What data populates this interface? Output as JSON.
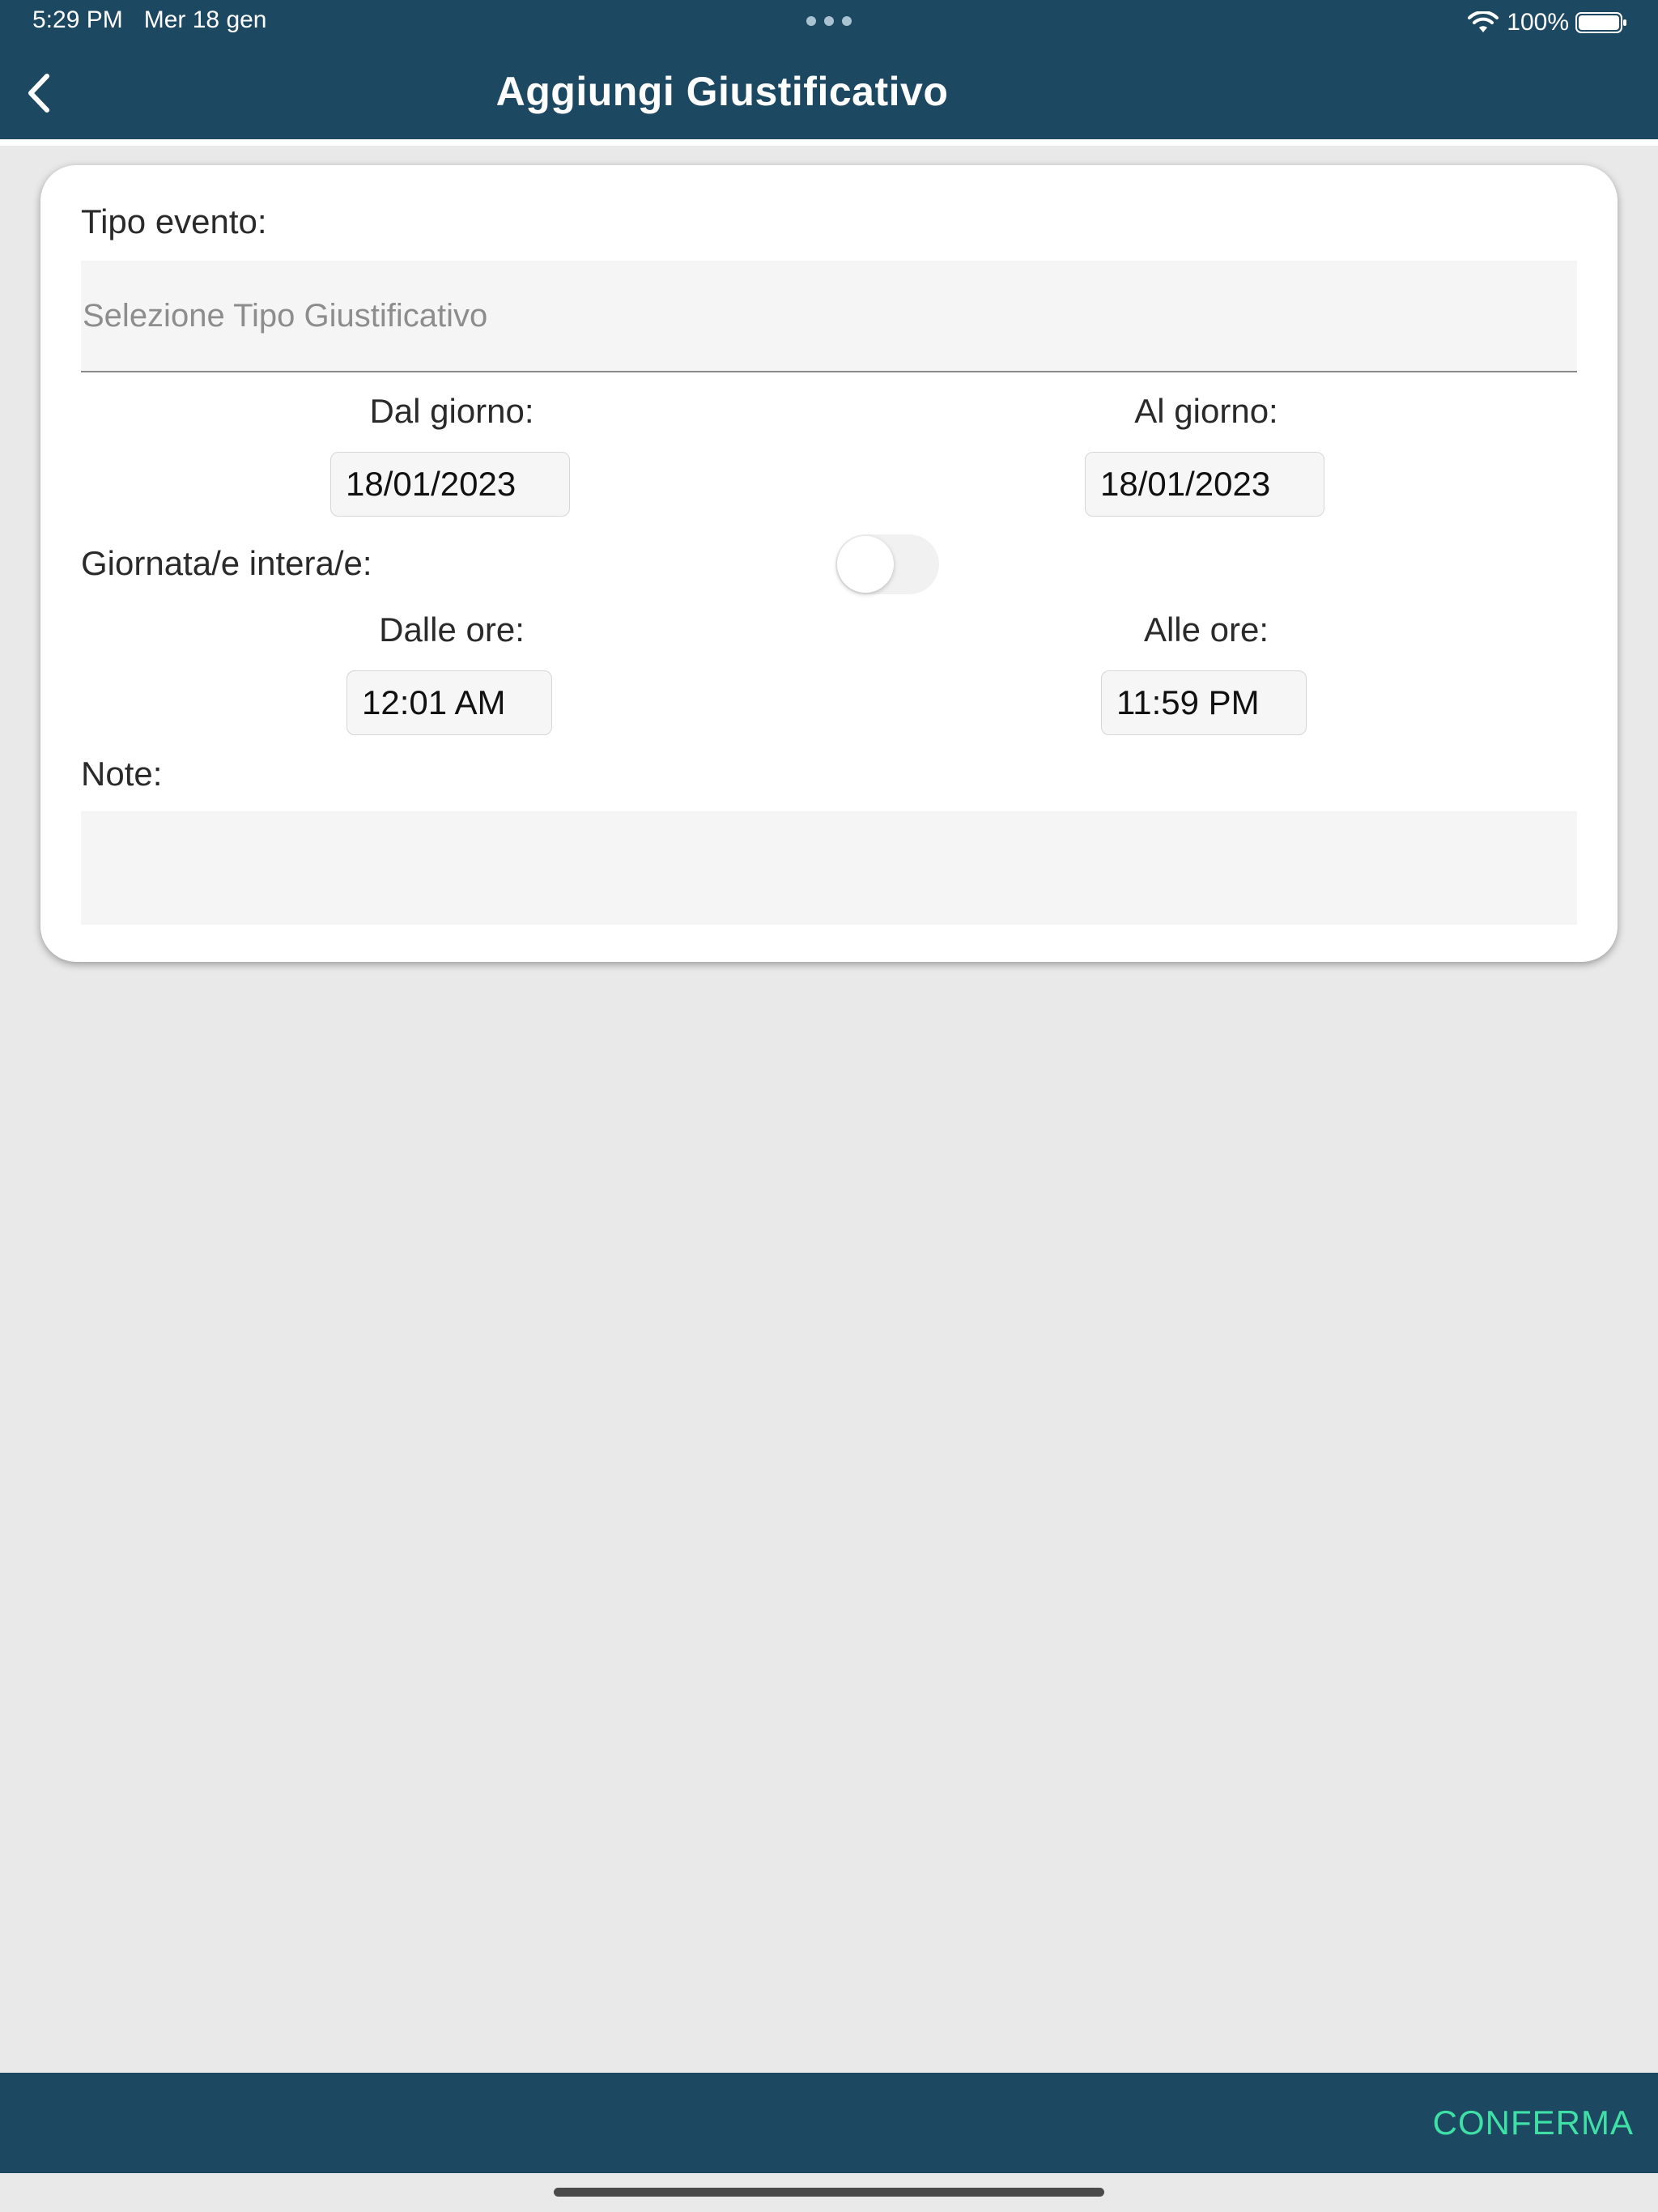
{
  "status_bar": {
    "time": "5:29 PM",
    "date": "Mer 18 gen",
    "battery_percent": "100%",
    "battery_level": 1.0,
    "icons": [
      "multitasking-dots-icon",
      "wifi-icon",
      "battery-icon"
    ]
  },
  "header": {
    "title": "Aggiungi Giustificativo",
    "back_icon": "chevron-left-icon"
  },
  "form": {
    "event_type_label": "Tipo evento:",
    "event_type_placeholder": "Selezione Tipo Giustificativo",
    "from_day_label": "Dal giorno:",
    "from_day_value": "18/01/2023",
    "to_day_label": "Al giorno:",
    "to_day_value": "18/01/2023",
    "full_day_label": "Giornata/e intera/e:",
    "full_day_enabled": false,
    "from_time_label": "Dalle ore:",
    "from_time_value": "12:01 AM",
    "to_time_label": "Alle ore:",
    "to_time_value": "11:59 PM",
    "notes_label": "Note:",
    "notes_value": ""
  },
  "footer": {
    "confirm_label": "CONFERMA"
  },
  "colors": {
    "bar": "#1d4861",
    "accent": "#3fe0a6",
    "background": "#e9e9ea"
  }
}
